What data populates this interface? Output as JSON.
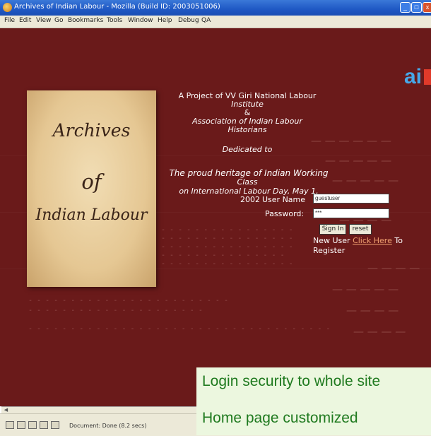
{
  "window": {
    "title": "Archives of Indian Labour - Mozilla (Build ID: 2003051006)",
    "minimize": "_",
    "maximize": "□",
    "close": "x"
  },
  "menubar": [
    "File",
    "Edit",
    "View",
    "Go",
    "Bookmarks",
    "Tools",
    "Window",
    "Help",
    "Debug",
    "QA"
  ],
  "logo": {
    "text": "ai"
  },
  "book": {
    "line1": "Archives",
    "line2": "of",
    "line3": "Indian Labour"
  },
  "project": {
    "line1": "A Project of VV Giri National Labour",
    "line2": "Institute",
    "line3": "&",
    "line4": "Association of Indian Labour",
    "line5": "Historians",
    "line6": "Dedicated to",
    "line7": "The proud heritage of Indian Working",
    "line8": "Class",
    "line9": "on International Labour Day, May 1,",
    "line10": "2002"
  },
  "login": {
    "username_label": "User Name",
    "username_value": "guestuser",
    "password_label": "Password:",
    "password_value": "***",
    "signin_label": "Sign In",
    "reset_label": "reset",
    "new_user_text": "New User ",
    "click_here": "Click Here",
    "to_text": " To",
    "register_text": "Register"
  },
  "status": {
    "text": "Document: Done (8.2 secs)"
  },
  "overlay": {
    "line1": "Login security to whole site",
    "line2": "Home page customized"
  },
  "colors": {
    "background": "#6a1a1a",
    "overlay_text": "#1f7a1f",
    "link": "#f0a070"
  }
}
